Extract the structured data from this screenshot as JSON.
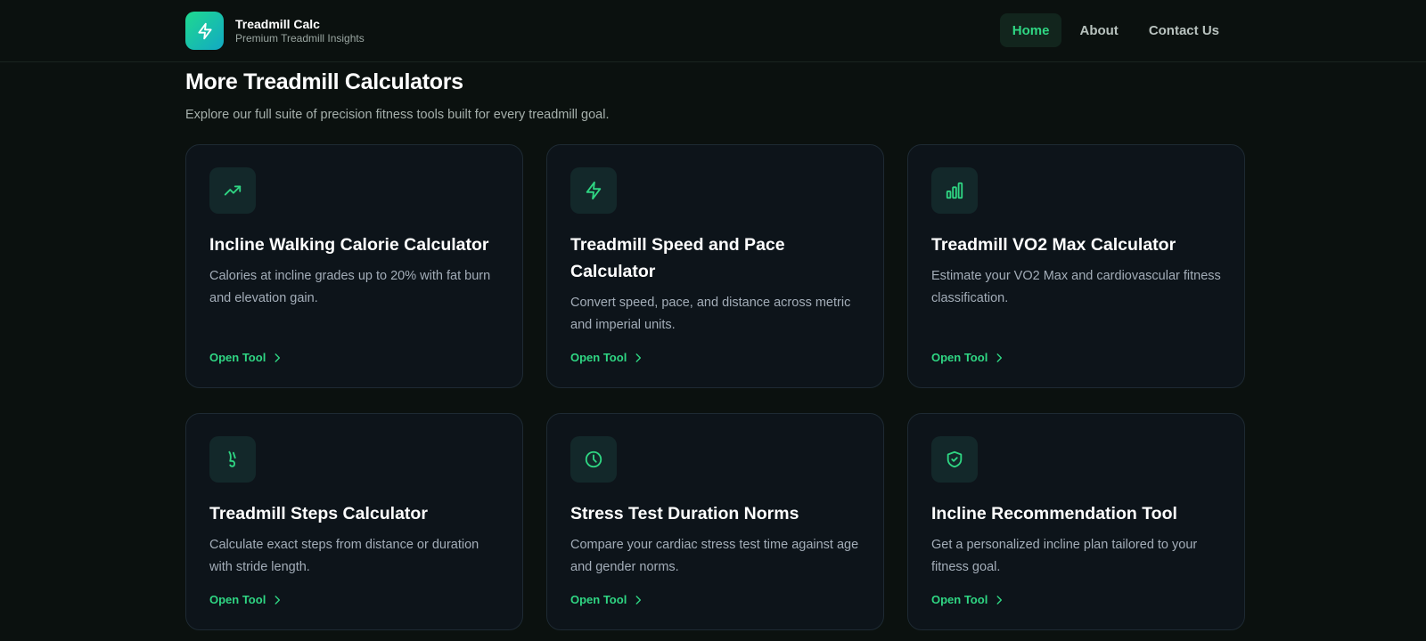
{
  "brand": {
    "title": "Treadmill Calc",
    "subtitle": "Premium Treadmill Insights",
    "logo_icon": "bolt-icon"
  },
  "nav": {
    "items": [
      {
        "label": "Home",
        "active": true
      },
      {
        "label": "About",
        "active": false
      },
      {
        "label": "Contact Us",
        "active": false
      }
    ]
  },
  "section": {
    "title": "More Treadmill Calculators",
    "subtitle": "Explore our full suite of precision fitness tools built for every treadmill goal."
  },
  "cards": [
    {
      "icon": "trending-up-icon",
      "title": "Incline Walking Calorie Calculator",
      "desc": "Calories at incline grades up to 20% with fat burn and elevation gain.",
      "link": "Open Tool"
    },
    {
      "icon": "bolt-icon",
      "title": "Treadmill Speed and Pace Calculator",
      "desc": "Convert speed, pace, and distance across metric and imperial units.",
      "link": "Open Tool"
    },
    {
      "icon": "bar-chart-icon",
      "title": "Treadmill VO2 Max Calculator",
      "desc": "Estimate your VO2 Max and cardiovascular fitness classification.",
      "link": "Open Tool"
    },
    {
      "icon": "footprints-icon",
      "title": "Treadmill Steps Calculator",
      "desc": "Calculate exact steps from distance or duration with stride length.",
      "link": "Open Tool"
    },
    {
      "icon": "clock-icon",
      "title": "Stress Test Duration Norms",
      "desc": "Compare your cardiac stress test time against age and gender norms.",
      "link": "Open Tool"
    },
    {
      "icon": "shield-check-icon",
      "title": "Incline Recommendation Tool",
      "desc": "Get a personalized incline plan tailored to your fitness goal.",
      "link": "Open Tool"
    }
  ],
  "colors": {
    "accent": "#2fd683",
    "background": "#0b110f",
    "card": "#0d141a"
  }
}
